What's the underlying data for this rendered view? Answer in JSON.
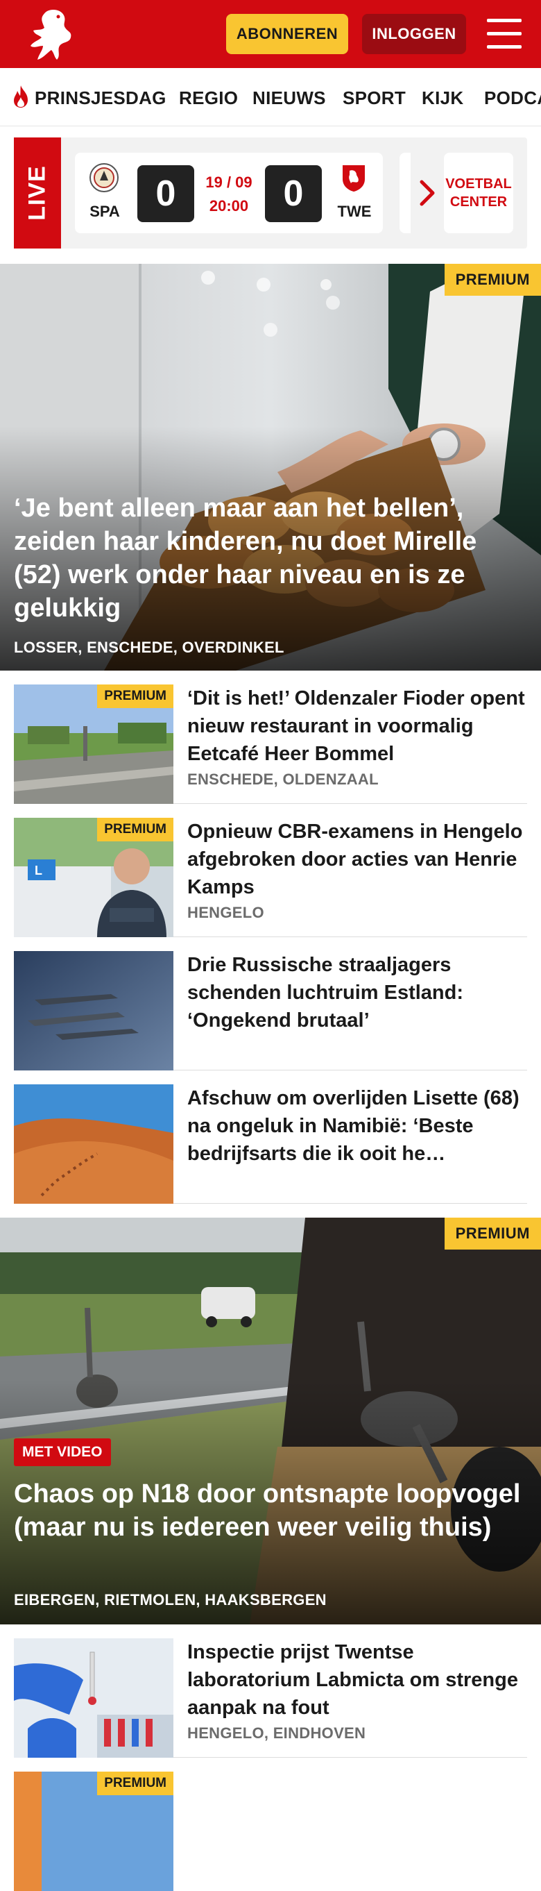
{
  "header": {
    "subscribe_label": "ABONNEREN",
    "login_label": "INLOGGEN",
    "brand_color": "#d10a11",
    "accent_color": "#f9c531"
  },
  "nav": {
    "items": [
      "PRINSJESDAG",
      "REGIO",
      "NIEUWS",
      "SPORT",
      "KIJK",
      "PODCA"
    ]
  },
  "live": {
    "tag": "LIVE",
    "home_team": "SPA",
    "away_team": "TWE",
    "home_score": "0",
    "away_score": "0",
    "date": "19 / 09",
    "time": "20:00",
    "center_line1": "VOETBAL",
    "center_line2": "CENTER"
  },
  "hero1": {
    "badge": "PREMIUM",
    "title": "‘Je bent alleen maar aan het bellen’, zeiden haar kinderen, nu doet Mirelle (52) werk onder haar niveau en is ze gelukkig",
    "tags": "LOSSER, ENSCHEDE, OVERDINKEL"
  },
  "articles": [
    {
      "premium": "PREMIUM",
      "title": "‘Dit is het!’ Oldenzaler Fioder opent nieuw restaurant in voormalig Eetcafé Heer Bommel",
      "tags": "ENSCHEDE, OLDENZAAL"
    },
    {
      "premium": "PREMIUM",
      "title": "Opnieuw CBR-examens in Hengelo afgebroken door acties van Henrie Kamps",
      "tags": "HENGELO"
    },
    {
      "premium": "",
      "title": "Drie Russische straaljagers schenden luchtruim Estland: ‘Ongekend brutaal’",
      "tags": ""
    },
    {
      "premium": "",
      "title": "Afschuw om overlijden Lisette (68) na ongeluk in Namibië: ‘Beste bedrijfsarts die ik ooit he…",
      "tags": ""
    }
  ],
  "hero2": {
    "badge": "PREMIUM",
    "video_badge": "MET VIDEO",
    "title": "Chaos op N18 door ontsnapte loopvogel (maar nu is iedereen weer veilig thuis)",
    "tags": "EIBERGEN, RIETMOLEN, HAAKSBERGEN"
  },
  "articles2": [
    {
      "premium": "",
      "title": "Inspectie prijst Twentse laboratorium Labmicta om strenge aanpak na fout",
      "tags": "HENGELO, EINDHOVEN"
    },
    {
      "premium": "PREMIUM",
      "title": "",
      "tags": ""
    }
  ]
}
